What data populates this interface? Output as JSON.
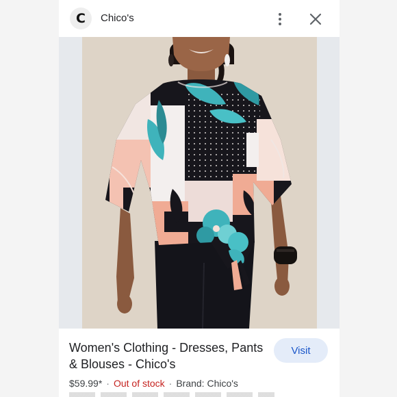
{
  "header": {
    "logo_letter": "C",
    "site_name": "Chico's",
    "more_icon": "more-vertical-icon",
    "close_icon": "close-icon"
  },
  "image": {
    "subject": "model wearing a black, blush and teal floral print kimono-sleeve blouse with a side tie and black pants",
    "colors": {
      "backdrop": "#e2d9cd",
      "black": "#17161c",
      "blush": "#f0ab94",
      "teal": "#3fb3bb",
      "pale": "#f1e6e2"
    }
  },
  "result": {
    "title": "Women's Clothing - Dresses, Pants & Blouses - Chico's",
    "visit_label": "Visit",
    "price": "$59.99*",
    "stock": "Out of stock",
    "brand": "Brand: Chico's"
  },
  "colors": {
    "visit_bg": "#e4ecf9",
    "visit_text": "#1a56c9",
    "out_of_stock": "#c5221f"
  }
}
